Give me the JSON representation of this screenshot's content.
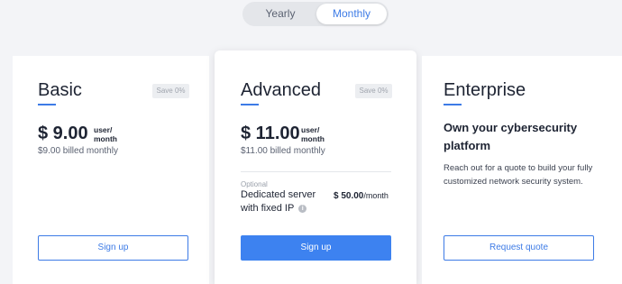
{
  "billing_toggle": {
    "yearly_label": "Yearly",
    "monthly_label": "Monthly",
    "selected": "Monthly"
  },
  "plans": {
    "basic": {
      "name": "Basic",
      "save_badge": "Save 0%",
      "price": "$ 9.00",
      "unit_line1": "user/",
      "unit_line2": "month",
      "billed": "$9.00 billed monthly",
      "button_label": "Sign up"
    },
    "advanced": {
      "name": "Advanced",
      "save_badge": "Save 0%",
      "price": "$ 11.00",
      "unit_line1": "user/",
      "unit_line2": "month",
      "billed": "$11.00 billed monthly",
      "addon": {
        "optional_label": "Optional",
        "text": "Dedicated server with fixed IP",
        "price": "$ 50.00",
        "per": "/month"
      },
      "button_label": "Sign up"
    },
    "enterprise": {
      "name": "Enterprise",
      "headline": "Own your cybersecurity platform",
      "description": "Reach out for a quote to build your fully customized network security system.",
      "button_label": "Request quote"
    }
  },
  "colors": {
    "accent": "#3d7be6",
    "primary_button": "#3d82f0",
    "page_background": "#f3f4f7"
  },
  "icons": {
    "info": "info-icon"
  }
}
